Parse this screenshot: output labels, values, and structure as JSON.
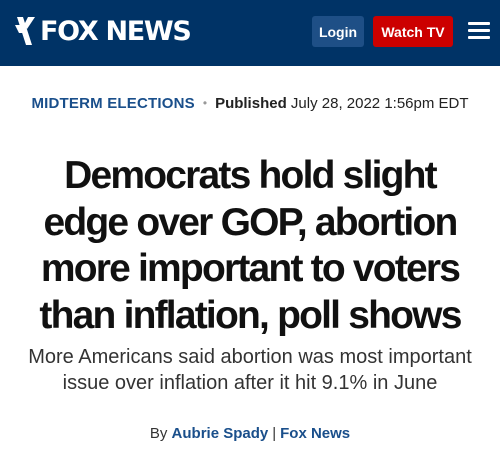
{
  "header": {
    "logo_text": "FOX NEWS",
    "login_label": "Login",
    "watch_label": "Watch TV",
    "menu_icon": "hamburger-menu-icon",
    "background_color": "#003366",
    "watch_color": "#cc0000"
  },
  "article": {
    "category": "MIDTERM ELECTIONS",
    "separator": "•",
    "published_label": "Published",
    "published_date": "July 28, 2022 1:56pm EDT",
    "headline": "Democrats hold slight edge over GOP, abortion more important to voters than inflation, poll shows",
    "subheadline": "More Americans said abortion was most important issue over inflation after it hit 9.1% in June",
    "byline_prefix": "By",
    "author": "Aubrie Spady",
    "byline_separator": "|",
    "outlet": "Fox News"
  }
}
